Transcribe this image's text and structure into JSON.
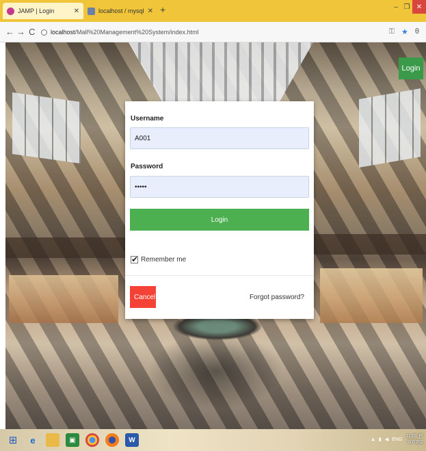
{
  "browser": {
    "tabs": [
      {
        "title": "JAMP | Login",
        "active": true
      },
      {
        "title": "localhost / mysql wampserver /",
        "active": false
      }
    ],
    "url_host": "localhost",
    "url_path": "/Mall%20Management%20System/index.html",
    "nav": {
      "back": "←",
      "forward": "→",
      "reload": "C"
    }
  },
  "page": {
    "login_corner_label": "Login"
  },
  "login_form": {
    "username_label": "Username",
    "username_value": "A001",
    "password_label": "Password",
    "password_value": "•••••",
    "login_button": "Login",
    "remember_label": "Remember me",
    "remember_checked": true,
    "cancel_button": "Cancel",
    "forgot_link": "Forgot password?"
  },
  "taskbar": {
    "tray_lang": "ENG",
    "clock_time": "11:00 PI",
    "clock_date": "3/7/202"
  },
  "colors": {
    "accent_green": "#4caf50",
    "cancel_red": "#f44336",
    "tab_yellow": "#f0c53a"
  }
}
